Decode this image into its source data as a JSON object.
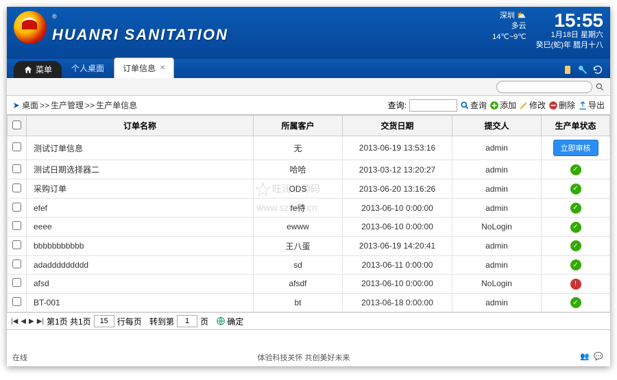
{
  "header": {
    "brand": "HUANRI SANITATION",
    "city": "深圳",
    "weather_desc": "多云",
    "temp": "14℃~9℃",
    "time": "15:55",
    "date": "1月18日 星期六",
    "lunar": "癸巳(蛇)年 腊月十八"
  },
  "tabs": {
    "menu": "菜单",
    "personal": "个人桌面",
    "orders": "订单信息"
  },
  "breadcrumb": {
    "desktop": "桌面",
    "sep": ">>",
    "prod": "生产管理",
    "info": "生产单信息"
  },
  "actions": {
    "query_label": "查询:",
    "query": "查询",
    "add": "添加",
    "edit": "修改",
    "delete": "删除",
    "export": "导出"
  },
  "columns": {
    "name": "订单名称",
    "customer": "所属客户",
    "date": "交货日期",
    "submitter": "提交人",
    "status": "生产单状态"
  },
  "rows": [
    {
      "name": "测试订单信息",
      "customer": "无",
      "date": "2013-06-19 13:53:16",
      "submitter": "admin",
      "status": "audit",
      "status_label": "立即审核"
    },
    {
      "name": "测试日期选择器二",
      "customer": "哈哈",
      "date": "2013-03-12 13:20:27",
      "submitter": "admin",
      "status": "ok"
    },
    {
      "name": "采购订单",
      "customer": "ODS",
      "date": "2013-06-20 13:16:26",
      "submitter": "admin",
      "status": "ok"
    },
    {
      "name": "efef",
      "customer": "fe待",
      "date": "2013-06-10 0:00:00",
      "submitter": "admin",
      "status": "ok"
    },
    {
      "name": "eeee",
      "customer": "ewww",
      "date": "2013-06-10 0:00:00",
      "submitter": "NoLogin",
      "status": "ok"
    },
    {
      "name": "bbbbbbbbbbb",
      "customer": "王八蛋",
      "date": "2013-06-19 14:20:41",
      "submitter": "admin",
      "status": "ok"
    },
    {
      "name": "adaddddddddd",
      "customer": "sd",
      "date": "2013-06-11 0:00:00",
      "submitter": "admin",
      "status": "ok"
    },
    {
      "name": "afsd",
      "customer": "afsdf",
      "date": "2013-06-10 0:00:00",
      "submitter": "NoLogin",
      "status": "err"
    },
    {
      "name": "BT-001",
      "customer": "bt",
      "date": "2013-06-18 0:00:00",
      "submitter": "admin",
      "status": "ok"
    }
  ],
  "pager": {
    "page_text": "第1页 共1页",
    "page_size": "15",
    "per_page": "行每页",
    "goto": "转到第",
    "goto_val": "1",
    "page_suffix": "页",
    "confirm": "确定"
  },
  "footer": {
    "online": "在线",
    "slogan": "体验科技关怀 共创美好未来"
  },
  "watermark": {
    "brand": "旺润达源码",
    "url": "www.szwrd.cn"
  }
}
